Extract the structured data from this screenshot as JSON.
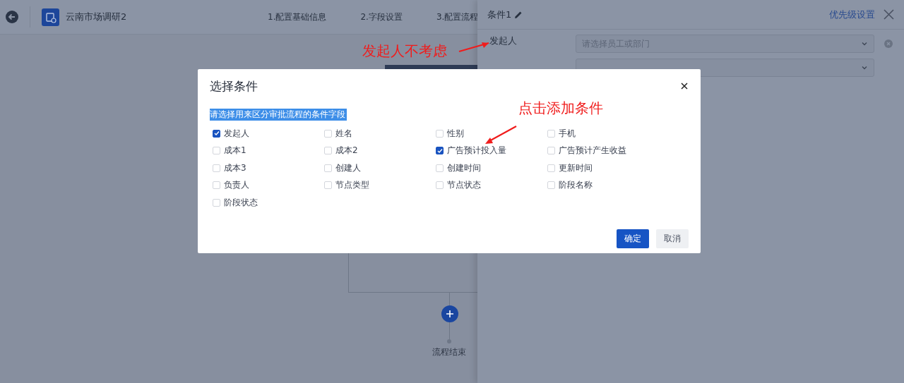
{
  "header": {
    "title": "云南市场调研2",
    "steps": [
      "1.配置基础信息",
      "2.字段设置",
      "3.配置流程"
    ]
  },
  "flow": {
    "end_label": "流程结束"
  },
  "drawer": {
    "title": "条件1",
    "priority_link": "优先级设置",
    "conditions": [
      {
        "label": "发起人",
        "selects": [
          {
            "placeholder": "请选择员工或部门"
          }
        ]
      }
    ]
  },
  "dialog": {
    "title": "选择条件",
    "hint": "请选择用来区分审批流程的条件字段",
    "options": [
      {
        "label": "发起人",
        "checked": true
      },
      {
        "label": "姓名",
        "checked": false
      },
      {
        "label": "性别",
        "checked": false
      },
      {
        "label": "手机",
        "checked": false
      },
      {
        "label": "成本1",
        "checked": false
      },
      {
        "label": "成本2",
        "checked": false
      },
      {
        "label": "广告预计投入量",
        "checked": true
      },
      {
        "label": "广告预计产生收益",
        "checked": false
      },
      {
        "label": "成本3",
        "checked": false
      },
      {
        "label": "创建人",
        "checked": false
      },
      {
        "label": "创建时间",
        "checked": false
      },
      {
        "label": "更新时间",
        "checked": false
      },
      {
        "label": "负责人",
        "checked": false
      },
      {
        "label": "节点类型",
        "checked": false
      },
      {
        "label": "节点状态",
        "checked": false
      },
      {
        "label": "阶段名称",
        "checked": false
      },
      {
        "label": "阶段状态",
        "checked": false
      }
    ],
    "buttons": [
      {
        "label": "确定",
        "kind": "primary"
      },
      {
        "label": "取消",
        "kind": "secondary"
      }
    ]
  },
  "annotations": [
    {
      "text": "发起人不考虑"
    },
    {
      "text": "点击添加条件"
    }
  ]
}
